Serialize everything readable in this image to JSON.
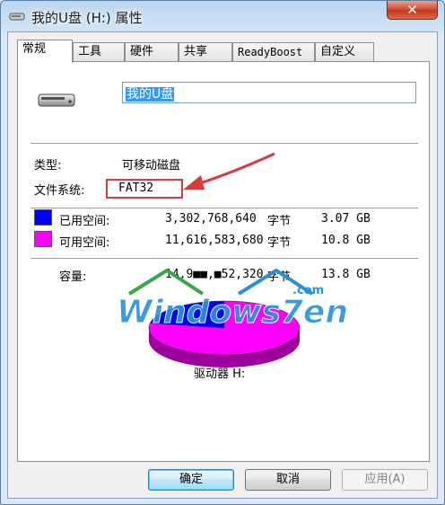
{
  "window": {
    "title": "我的U盘 (H:) 属性",
    "close_glyph": "✕"
  },
  "tabs": [
    {
      "label": "常规",
      "active": true
    },
    {
      "label": "工具",
      "active": false
    },
    {
      "label": "硬件",
      "active": false
    },
    {
      "label": "共享",
      "active": false
    },
    {
      "label": "ReadyBoost",
      "active": false
    },
    {
      "label": "自定义",
      "active": false
    }
  ],
  "general": {
    "drive_name": "我的U盘",
    "type_label": "类型:",
    "type_value": "可移动磁盘",
    "fs_label": "文件系统:",
    "fs_value": "FAT32",
    "used": {
      "label": "已用空间:",
      "bytes": "3,302,768,640",
      "unit": "字节",
      "size": "3.07 GB",
      "color": "#0000ff"
    },
    "free": {
      "label": "可用空间:",
      "bytes": "11,616,583,680",
      "unit": "字节",
      "size": "10.8 GB",
      "color": "#ff00ff"
    },
    "capacity": {
      "label": "容量:",
      "bytes": "14,9■■,■52,320",
      "unit": "字节",
      "size": "13.8 GB"
    },
    "drive_label": "驱动器 H:"
  },
  "chart_data": {
    "type": "pie",
    "categories": [
      "已用空间",
      "可用空间"
    ],
    "values": [
      3302768640,
      11616583680
    ],
    "colors": [
      "#0000ff",
      "#ff00ff"
    ]
  },
  "watermark": {
    "text": "Windows7en",
    "suffix": ".com"
  },
  "buttons": {
    "ok": "确定",
    "cancel": "取消",
    "apply": "应用(A)"
  }
}
